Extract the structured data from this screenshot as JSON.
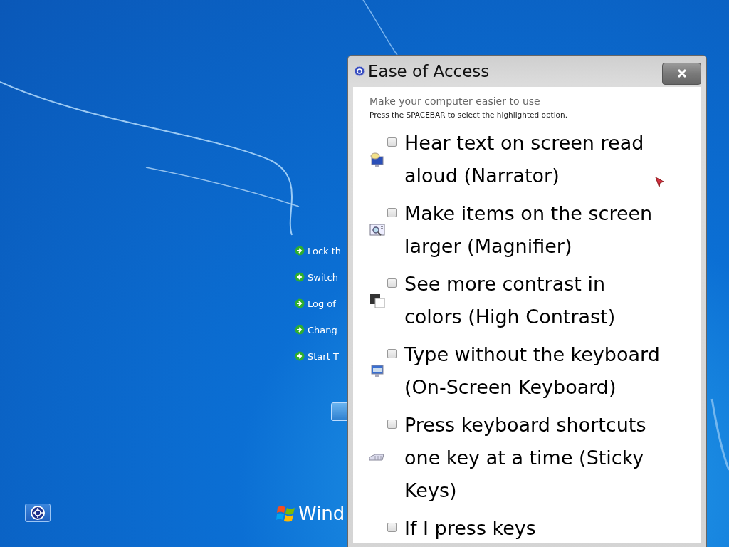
{
  "desktop": {
    "links": [
      {
        "label": "Lock th"
      },
      {
        "label": "Switch"
      },
      {
        "label": "Log of"
      },
      {
        "label": "Chang"
      },
      {
        "label": "Start T"
      }
    ],
    "brand": "Wind"
  },
  "dialog": {
    "title": "Ease of Access",
    "heading": "Make your computer easier to use",
    "hint": "Press the SPACEBAR to select the highlighted option.",
    "options": [
      {
        "kind": "narrator",
        "label": "Hear text on screen read aloud (Narrator)",
        "checked": false
      },
      {
        "kind": "magnifier",
        "label": "Make items on the screen larger (Magnifier)",
        "checked": false
      },
      {
        "kind": "contrast",
        "label": "See more contrast in colors (High Contrast)",
        "checked": false
      },
      {
        "kind": "keyboard",
        "label": "Type without the keyboard (On-Screen Keyboard)",
        "checked": false
      },
      {
        "kind": "sticky",
        "label": "Press keyboard shortcuts one key at a time (Sticky Keys)",
        "checked": false
      },
      {
        "kind": "filter",
        "label": "If I press keys",
        "checked": false
      }
    ]
  }
}
